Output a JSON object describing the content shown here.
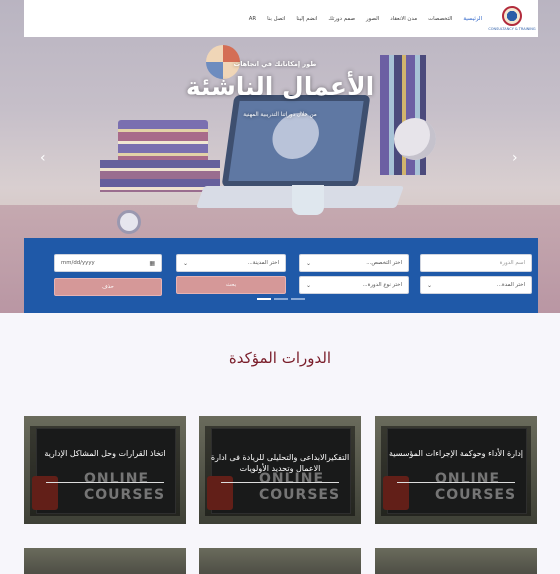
{
  "nav": {
    "logo_caption": "CONSULTANCY & TRAINING",
    "items": [
      "الرئيسية",
      "التخصصات",
      "مدن الانعقاد",
      "الصور",
      "صمم دورتك",
      "انضم إلينا",
      "اتصل بنا",
      "AR"
    ],
    "active_index": 0
  },
  "hero": {
    "subtitle": "طور إمكاناتك في اتجاهات",
    "title": "الأعمال الناشئة",
    "description": "من خلال دوراتنا التدريبية المهنية",
    "prev_icon": "chevron-left-icon",
    "next_icon": "chevron-right-icon"
  },
  "search": {
    "course_name_placeholder": "اسم الدورة",
    "specialty_label": "اختر التخصص...",
    "city_label": "اختر المدينة...",
    "date_placeholder": "mm/dd/yyyy",
    "period_label": "اختر المدة...",
    "course_type_label": "اختر نوع الدورة...",
    "search_button": "بحث",
    "delete_button": "حذف",
    "colors": {
      "panel": "#1f59a8",
      "button": "#d59898"
    }
  },
  "section": {
    "title": "الدورات المؤكدة",
    "cards": [
      {
        "title": "إدارة الأداء وحوكمة الإجراءات المؤسسية",
        "image_text": "ONLINE COURSES"
      },
      {
        "title": "التفكيرالابداعى والتحليلى للريادة فى ادارة الاعمال وتحديد الأولويات",
        "image_text": "ONLINE COURSES"
      },
      {
        "title": "اتخاذ القرارات وحل المشاكل الإدارية",
        "image_text": "ONLINE COURSES"
      }
    ]
  }
}
